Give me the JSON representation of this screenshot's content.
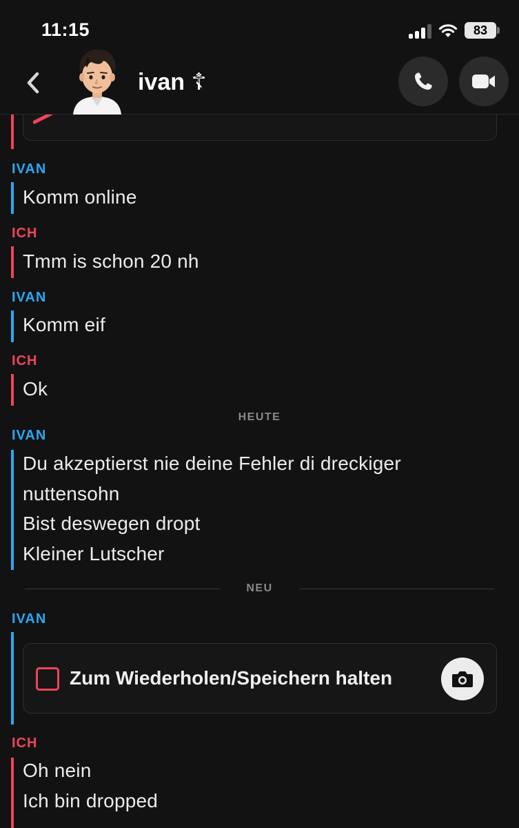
{
  "status_bar": {
    "time": "11:15",
    "battery": "83",
    "icons": [
      "signal-icon",
      "wifi-icon",
      "battery-icon"
    ]
  },
  "header": {
    "contact_name": "ivan ☦",
    "icons": [
      "back-chevron-icon",
      "bitmoji-avatar",
      "phone-icon",
      "video-camera-icon"
    ]
  },
  "colors": {
    "background": "#121212",
    "friend_accent": "#2aa8f2",
    "me_accent": "#f2445a",
    "card_bg": "#161616"
  },
  "chat": {
    "groups": [
      {
        "sender": "IVAN",
        "messages": [
          "Komm online"
        ]
      },
      {
        "sender": "ICH",
        "messages": [
          "Tmm is schon 20 nh"
        ]
      },
      {
        "sender": "IVAN",
        "messages": [
          "Komm eif"
        ]
      },
      {
        "sender": "ICH",
        "messages": [
          "Ok"
        ]
      },
      {
        "sender": "IVAN",
        "messages": [
          "Du akzeptierst nie deine Fehler di dreckiger",
          "nuttensohn",
          "Bist deswegen dropt",
          "Kleiner Lutscher"
        ]
      },
      {
        "sender": "IVAN",
        "snap_label": "Zum Wiederholen/Speichern halten"
      },
      {
        "sender": "ICH",
        "messages": [
          "Oh nein",
          "Ich bin dropped"
        ]
      }
    ],
    "separators": {
      "today": "HEUTE",
      "new": "NEU"
    }
  }
}
